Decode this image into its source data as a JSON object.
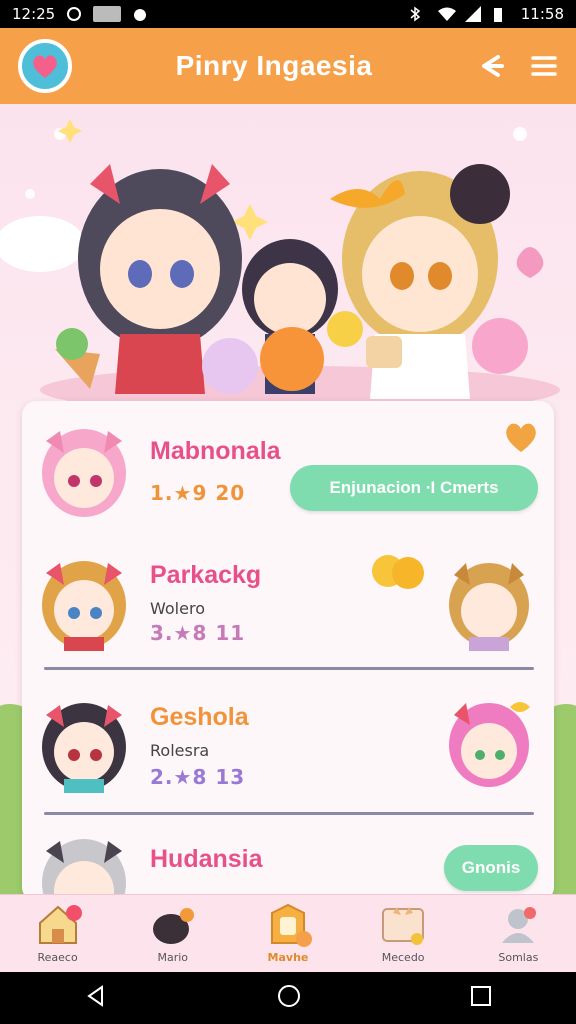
{
  "status_bar": {
    "time_left": "12:25",
    "time_right": "11:58"
  },
  "app": {
    "title": "Pinry Ingaesia"
  },
  "list": [
    {
      "name": "Mabnonala",
      "subtitle": "",
      "stats": "1.★9 20",
      "name_color": "#e8508a",
      "stats_color": "#f0933a",
      "action": "Enjunacion ∙I Cmerts"
    },
    {
      "name": "Parkackg",
      "subtitle": "Wolero",
      "stats": "3.★8 11",
      "name_color": "#e8508a",
      "stats_color": "#c67ab8",
      "action": ""
    },
    {
      "name": "Gesholа",
      "subtitle": "Rolesra",
      "stats": "2.★8 13",
      "name_color": "#f0933a",
      "stats_color": "#9a79d6",
      "action": ""
    },
    {
      "name": "Hudansia",
      "subtitle": "",
      "stats": "",
      "name_color": "#e8508a",
      "stats_color": "#c67ab8",
      "action": "Gnonis"
    }
  ],
  "bottom_nav": [
    {
      "label": "Reaeco",
      "icon": "house-icon"
    },
    {
      "label": "Mario",
      "icon": "critter-icon"
    },
    {
      "label": "Mavhe",
      "icon": "shield-heart-icon"
    },
    {
      "label": "Mecedo",
      "icon": "cat-card-icon"
    },
    {
      "label": "Somlas",
      "icon": "profile-icon"
    }
  ],
  "colors": {
    "accent": "#f7a04a",
    "pill": "#7fdcae",
    "background": "#fde9f0"
  }
}
